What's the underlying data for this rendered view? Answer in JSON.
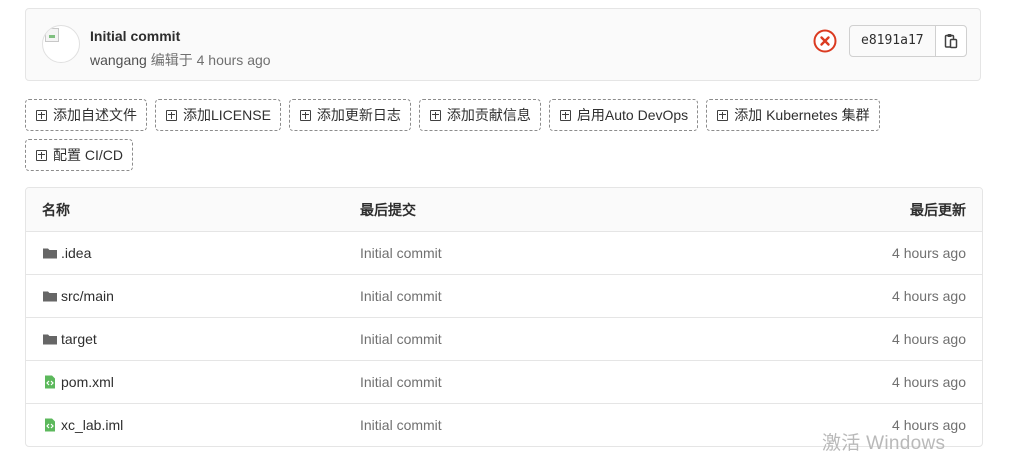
{
  "commit": {
    "title": "Initial commit",
    "author": "wangang",
    "edited_text": "编辑于 4 hours ago",
    "sha": "e8191a17",
    "status": "failed",
    "status_color": "#db3b21"
  },
  "actions": [
    {
      "label": "添加自述文件"
    },
    {
      "label": "添加LICENSE"
    },
    {
      "label": "添加更新日志"
    },
    {
      "label": "添加贡献信息"
    },
    {
      "label": "启用Auto DevOps"
    },
    {
      "label": "添加 Kubernetes 集群"
    },
    {
      "label": "配置 CI/CD"
    }
  ],
  "tree": {
    "headers": {
      "name": "名称",
      "last_commit": "最后提交",
      "last_update": "最后更新"
    },
    "rows": [
      {
        "type": "folder",
        "name": ".idea",
        "commit": "Initial commit",
        "updated": "4 hours ago"
      },
      {
        "type": "folder",
        "name": "src/main",
        "commit": "Initial commit",
        "updated": "4 hours ago"
      },
      {
        "type": "folder",
        "name": "target",
        "commit": "Initial commit",
        "updated": "4 hours ago"
      },
      {
        "type": "file",
        "name": "pom.xml",
        "commit": "Initial commit",
        "updated": "4 hours ago"
      },
      {
        "type": "file",
        "name": "xc_lab.iml",
        "commit": "Initial commit",
        "updated": "4 hours ago"
      }
    ]
  },
  "colors": {
    "folder_icon": "#666666",
    "file_icon": "#5cb85c"
  },
  "watermark": "激活 Windows"
}
